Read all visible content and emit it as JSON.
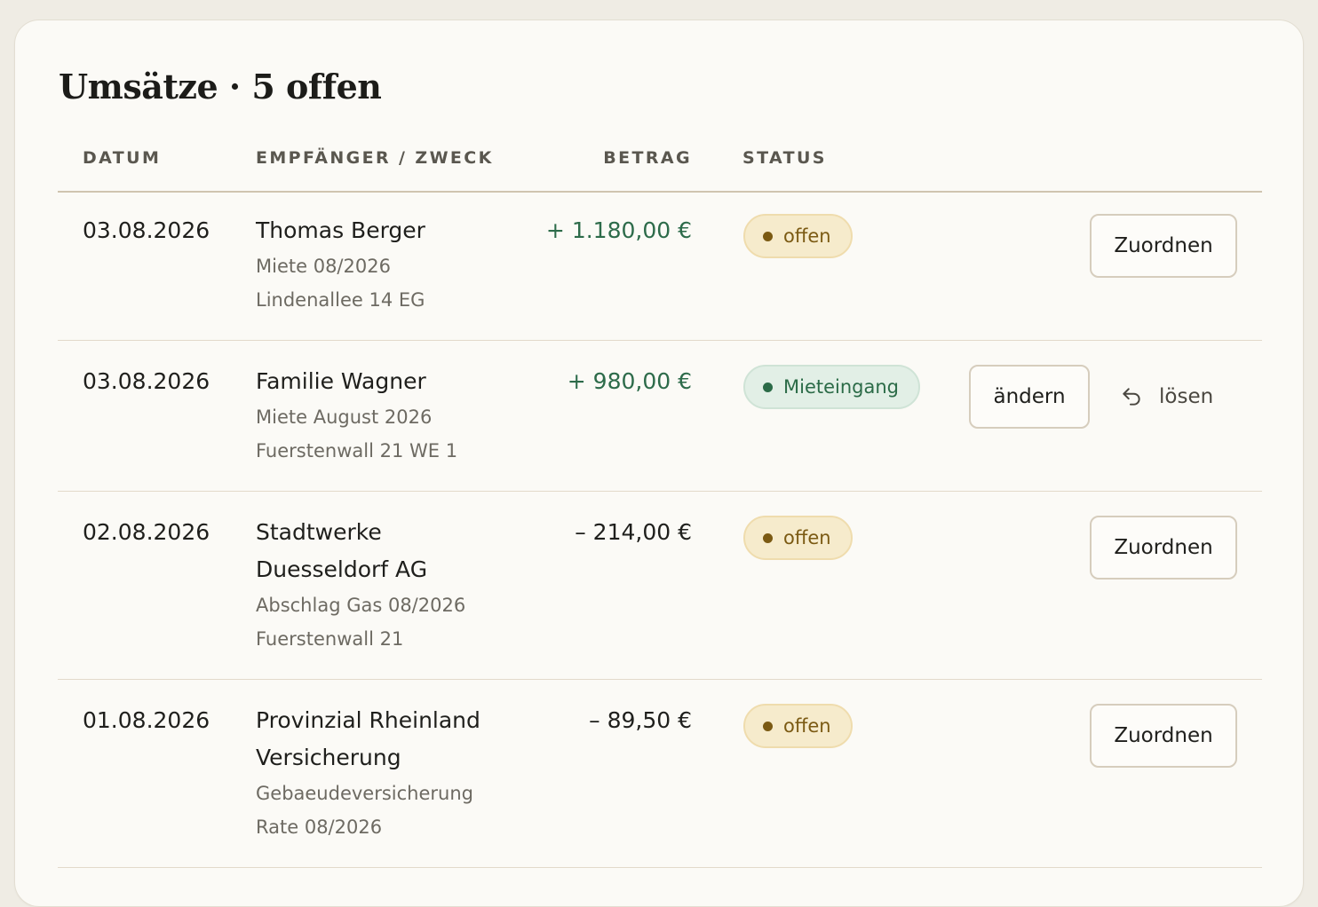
{
  "title": "Umsätze · 5 offen",
  "columns": {
    "date": "DATUM",
    "payee": "EMPFÄNGER / ZWECK",
    "amount": "BETRAG",
    "status": "STATUS"
  },
  "rows": [
    {
      "date": "03.08.2026",
      "payee": "Thomas Berger",
      "lines": [
        "Miete 08/2026",
        "Lindenallee 14 EG"
      ],
      "amount": "+ 1.180,00 €",
      "sign": "positive",
      "status": "offen",
      "status_type": "open",
      "action": "Zuordnen"
    },
    {
      "date": "03.08.2026",
      "payee": "Familie Wagner",
      "lines": [
        "Miete August 2026",
        "Fuerstenwall 21 WE 1"
      ],
      "amount": "+ 980,00 €",
      "sign": "positive",
      "status": "Mieteingang",
      "status_type": "matched",
      "action": "ändern",
      "secondary_action": "lösen",
      "secondary_icon": "undo-icon"
    },
    {
      "date": "02.08.2026",
      "payee_lines": [
        "Stadtwerke",
        "Duesseldorf AG"
      ],
      "lines": [
        "Abschlag Gas 08/2026",
        "Fuerstenwall 21"
      ],
      "amount": "– 214,00 €",
      "sign": "negative",
      "status": "offen",
      "status_type": "open",
      "action": "Zuordnen"
    },
    {
      "date": "01.08.2026",
      "payee_lines": [
        "Provinzial Rheinland",
        "Versicherung"
      ],
      "lines": [
        "Gebaeudeversicherung",
        "Rate 08/2026"
      ],
      "amount": "– 89,50 €",
      "sign": "negative",
      "status": "offen",
      "status_type": "open",
      "action": "Zuordnen"
    }
  ],
  "colors": {
    "page_bg": "#efece4",
    "card_bg": "#fbfaf6",
    "positive_amount": "#2d6b4a",
    "open_badge_bg": "#f6ebcc",
    "open_badge_text": "#7b5a13",
    "matched_badge_bg": "#e2efe6",
    "matched_badge_text": "#2b6b47"
  }
}
